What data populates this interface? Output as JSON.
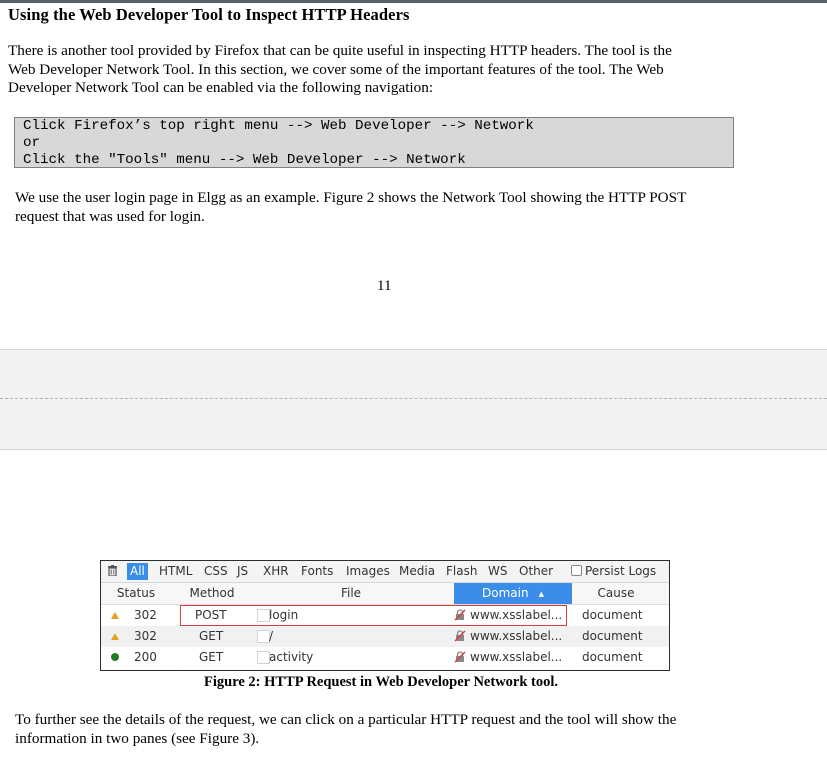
{
  "section": {
    "title": "Using the Web Developer Tool to Inspect HTTP Headers",
    "intro_lines": [
      "There is another tool provided by Firefox that can be quite useful in inspecting HTTP headers. The tool is the",
      "Web Developer Network Tool. In this section, we cover some of the important features of the tool. The Web",
      "Developer Network Tool can be enabled via the following navigation:"
    ],
    "code_lines": [
      "Click Firefox’s top right menu --> Web Developer --> Network",
      "or",
      "Click the \"Tools\" menu --> Web Developer --> Network"
    ],
    "example_lines": [
      "We use the user login page in Elgg as an example. Figure 2 shows the Network Tool showing the HTTP POST",
      "request that was used for login."
    ],
    "page_number": "11"
  },
  "network_tool": {
    "filters": [
      "All",
      "HTML",
      "CSS",
      "JS",
      "XHR",
      "Fonts",
      "Images",
      "Media",
      "Flash",
      "WS",
      "Other"
    ],
    "active_filter": "All",
    "persist_logs_label": "Persist Logs",
    "columns": {
      "status": "Status",
      "method": "Method",
      "file": "File",
      "domain": "Domain",
      "cause": "Cause"
    },
    "rows": [
      {
        "indicator": "warning",
        "status": "302",
        "method": "POST",
        "file": "login",
        "domain": "www.xsslabel...",
        "cause": "document"
      },
      {
        "indicator": "warning",
        "status": "302",
        "method": "GET",
        "file": "/",
        "domain": "www.xsslabel...",
        "cause": "document"
      },
      {
        "indicator": "success",
        "status": "200",
        "method": "GET",
        "file": "activity",
        "domain": "www.xsslabel...",
        "cause": "document"
      }
    ],
    "colors": {
      "accent": "#3a8eea",
      "highlight": "#d24040",
      "warning": "#e3a21f",
      "success": "#1e7d1e"
    }
  },
  "figure_caption": "Figure 2: HTTP Request in Web Developer Network tool.",
  "followup_lines": [
    "To further see the details of the request, we can click on a particular HTTP request and the tool will show the",
    "information in two panes (see Figure 3)."
  ]
}
